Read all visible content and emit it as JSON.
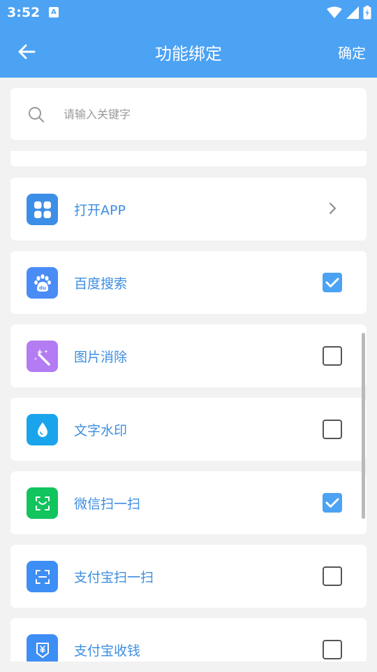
{
  "status_bar": {
    "time": "3:52",
    "notification_letter": "A"
  },
  "app_bar": {
    "title": "功能绑定",
    "confirm_label": "确定"
  },
  "search": {
    "placeholder": "请输入关键字",
    "value": ""
  },
  "items": [
    {
      "label": "打开APP",
      "icon": "grid-icon",
      "icon_color": "#3d8ee6",
      "control": "chevron"
    },
    {
      "label": "百度搜索",
      "icon": "baidu-paw-icon",
      "icon_color": "#4a8cf5",
      "control": "checkbox",
      "checked": true
    },
    {
      "label": "图片消除",
      "icon": "magic-wand-icon",
      "icon_color": "#b37cf2",
      "control": "checkbox",
      "checked": false
    },
    {
      "label": "文字水印",
      "icon": "water-drop-icon",
      "icon_color": "#1aa4ec",
      "control": "checkbox",
      "checked": false
    },
    {
      "label": "微信扫一扫",
      "icon": "wechat-scan-icon",
      "icon_color": "#12c45d",
      "control": "checkbox",
      "checked": true
    },
    {
      "label": "支付宝扫一扫",
      "icon": "scan-frame-icon",
      "icon_color": "#3d8ef5",
      "control": "checkbox",
      "checked": false
    },
    {
      "label": "支付宝收钱",
      "icon": "yuan-receipt-icon",
      "icon_color": "#3d8ef5",
      "control": "checkbox",
      "checked": false
    }
  ],
  "colors": {
    "primary": "#4ca2f3",
    "label_text": "#3d8ee0",
    "background": "#f2f2f2"
  }
}
